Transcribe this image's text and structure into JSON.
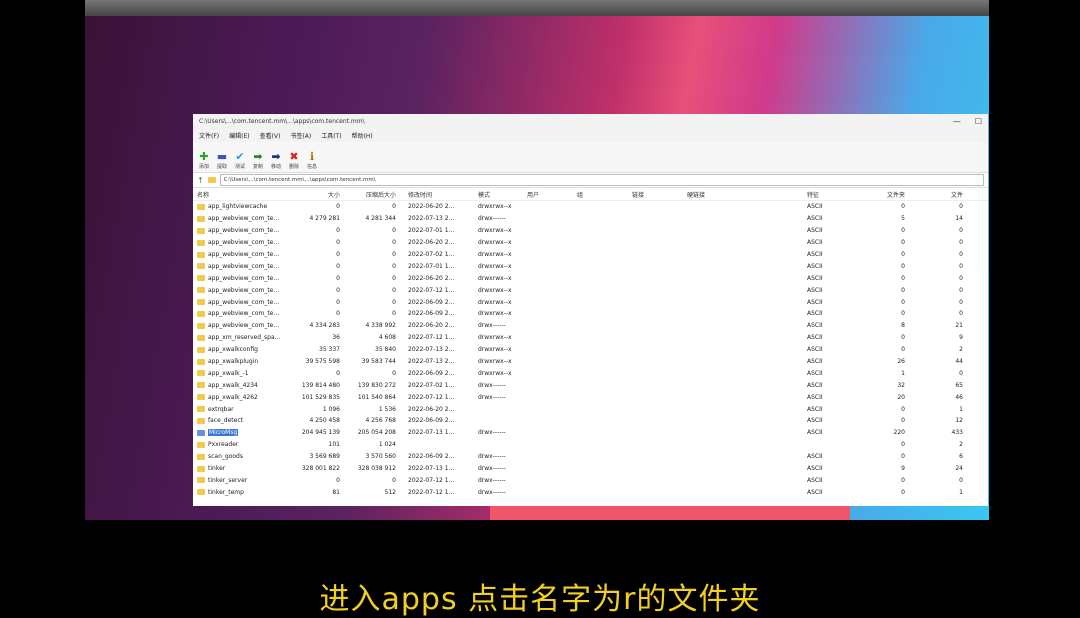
{
  "window": {
    "title": "C:\\Users\\...\\com.tencent.mm\\...\\apps\\com.tencent.mm\\",
    "controls": [
      "—",
      "☐"
    ]
  },
  "menu": [
    "文件(F)",
    "编辑(E)",
    "查看(V)",
    "书签(A)",
    "工具(T)",
    "帮助(H)"
  ],
  "toolbar": [
    {
      "icon": "add-icon",
      "glyph": "✚",
      "color": "#2aa52a",
      "label": "添加"
    },
    {
      "icon": "extract-icon",
      "glyph": "▬",
      "color": "#3355cc",
      "label": "提取"
    },
    {
      "icon": "test-icon",
      "glyph": "✔",
      "color": "#2a9ad8",
      "label": "测试"
    },
    {
      "icon": "copy-icon",
      "glyph": "➡",
      "color": "#2a8a2a",
      "label": "复制"
    },
    {
      "icon": "move-icon",
      "glyph": "➡",
      "color": "#223388",
      "label": "移动"
    },
    {
      "icon": "delete-icon",
      "glyph": "✖",
      "color": "#d32020",
      "label": "删除"
    },
    {
      "icon": "info-icon",
      "glyph": "ℹ",
      "color": "#a07a10",
      "label": "信息"
    }
  ],
  "address": "C:\\Users\\...\\com.tencent.mm\\...\\apps\\com.tencent.mm\\",
  "columns": {
    "name": "名称",
    "size": "大小",
    "packed": "压缩后大小",
    "modified": "修改时间",
    "attr": "模式",
    "user": "用户",
    "group": "组",
    "link": "链接",
    "link2": "硬链接",
    "host": "特征",
    "folders": "文件夹",
    "files": "文件"
  },
  "rows": [
    {
      "name": "app_lightviewcache",
      "size": "0",
      "packed": "0",
      "modified": "2022-06-20 2...",
      "attr": "drwxrwx--x",
      "host": "ASCII",
      "folders": "0",
      "files": "0"
    },
    {
      "name": "app_webview_com_te...",
      "size": "4 279 281",
      "packed": "4 281 344",
      "modified": "2022-07-13 2...",
      "attr": "drwx------",
      "host": "ASCII",
      "folders": "5",
      "files": "14"
    },
    {
      "name": "app_webview_com_te...",
      "size": "0",
      "packed": "0",
      "modified": "2022-07-01 1...",
      "attr": "drwxrwx--x",
      "host": "ASCII",
      "folders": "0",
      "files": "0"
    },
    {
      "name": "app_webview_com_te...",
      "size": "0",
      "packed": "0",
      "modified": "2022-06-20 2...",
      "attr": "drwxrwx--x",
      "host": "ASCII",
      "folders": "0",
      "files": "0"
    },
    {
      "name": "app_webview_com_te...",
      "size": "0",
      "packed": "0",
      "modified": "2022-07-02 1...",
      "attr": "drwxrwx--x",
      "host": "ASCII",
      "folders": "0",
      "files": "0"
    },
    {
      "name": "app_webview_com_te...",
      "size": "0",
      "packed": "0",
      "modified": "2022-07-01 1...",
      "attr": "drwxrwx--x",
      "host": "ASCII",
      "folders": "0",
      "files": "0"
    },
    {
      "name": "app_webview_com_te...",
      "size": "0",
      "packed": "0",
      "modified": "2022-06-20 2...",
      "attr": "drwxrwx--x",
      "host": "ASCII",
      "folders": "0",
      "files": "0"
    },
    {
      "name": "app_webview_com_te...",
      "size": "0",
      "packed": "0",
      "modified": "2022-07-12 1...",
      "attr": "drwxrwx--x",
      "host": "ASCII",
      "folders": "0",
      "files": "0"
    },
    {
      "name": "app_webview_com_te...",
      "size": "0",
      "packed": "0",
      "modified": "2022-06-09 2...",
      "attr": "drwxrwx--x",
      "host": "ASCII",
      "folders": "0",
      "files": "0"
    },
    {
      "name": "app_webview_com_te...",
      "size": "0",
      "packed": "0",
      "modified": "2022-06-09 2...",
      "attr": "drwxrwx--x",
      "host": "ASCII",
      "folders": "0",
      "files": "0"
    },
    {
      "name": "app_webview_com_te...",
      "size": "4 334 283",
      "packed": "4 338 992",
      "modified": "2022-06-20 2...",
      "attr": "drwx------",
      "host": "ASCII",
      "folders": "8",
      "files": "21"
    },
    {
      "name": "app_xm_reserved_spa...",
      "size": "36",
      "packed": "4 608",
      "modified": "2022-07-12 1...",
      "attr": "drwxrwx--x",
      "host": "ASCII",
      "folders": "0",
      "files": "9"
    },
    {
      "name": "app_xwalkconfig",
      "size": "35 337",
      "packed": "35 840",
      "modified": "2022-07-13 2...",
      "attr": "drwxrwx--x",
      "host": "ASCII",
      "folders": "0",
      "files": "2"
    },
    {
      "name": "app_xwalkplugin",
      "size": "39 575 598",
      "packed": "39 583 744",
      "modified": "2022-07-13 2...",
      "attr": "drwxrwx--x",
      "host": "ASCII",
      "folders": "26",
      "files": "44"
    },
    {
      "name": "app_xwalk_-1",
      "size": "0",
      "packed": "0",
      "modified": "2022-06-09 2...",
      "attr": "drwxrwx--x",
      "host": "ASCII",
      "folders": "1",
      "files": "0"
    },
    {
      "name": "app_xwalk_4234",
      "size": "139 814 480",
      "packed": "139 830 272",
      "modified": "2022-07-02 1...",
      "attr": "drwx------",
      "host": "ASCII",
      "folders": "32",
      "files": "65"
    },
    {
      "name": "app_xwalk_4262",
      "size": "101 529 835",
      "packed": "101 540 864",
      "modified": "2022-07-12 1...",
      "attr": "drwx------",
      "host": "ASCII",
      "folders": "20",
      "files": "46"
    },
    {
      "name": "extrqbar",
      "size": "1 096",
      "packed": "1 536",
      "modified": "2022-06-20 2...",
      "attr": "",
      "host": "ASCII",
      "folders": "0",
      "files": "1"
    },
    {
      "name": "face_detect",
      "size": "4 250 458",
      "packed": "4 256 768",
      "modified": "2022-06-09 2...",
      "attr": "",
      "host": "ASCII",
      "folders": "0",
      "files": "12"
    },
    {
      "name": "MicroMsg",
      "size": "204 945 139",
      "packed": "205 054 208",
      "modified": "2022-07-13 1...",
      "attr": "drwx------",
      "host": "ASCII",
      "folders": "220",
      "files": "433",
      "selected": true
    },
    {
      "name": "Pxxreader",
      "size": "101",
      "packed": "1 024",
      "modified": "",
      "attr": "",
      "host": "",
      "folders": "0",
      "files": "2"
    },
    {
      "name": "scan_goods",
      "size": "3 569 689",
      "packed": "3 570 560",
      "modified": "2022-06-09 2...",
      "attr": "drwx------",
      "host": "ASCII",
      "folders": "0",
      "files": "6"
    },
    {
      "name": "tinker",
      "size": "328 001 822",
      "packed": "328 038 912",
      "modified": "2022-07-13 1...",
      "attr": "drwx------",
      "host": "ASCII",
      "folders": "9",
      "files": "24"
    },
    {
      "name": "tinker_server",
      "size": "0",
      "packed": "0",
      "modified": "2022-07-12 1...",
      "attr": "drwx------",
      "host": "ASCII",
      "folders": "0",
      "files": "0"
    },
    {
      "name": "tinker_temp",
      "size": "81",
      "packed": "512",
      "modified": "2022-07-12 1...",
      "attr": "drwx------",
      "host": "ASCII",
      "folders": "0",
      "files": "1"
    }
  ],
  "subtitle": "进入apps 点击名字为r的文件夹"
}
